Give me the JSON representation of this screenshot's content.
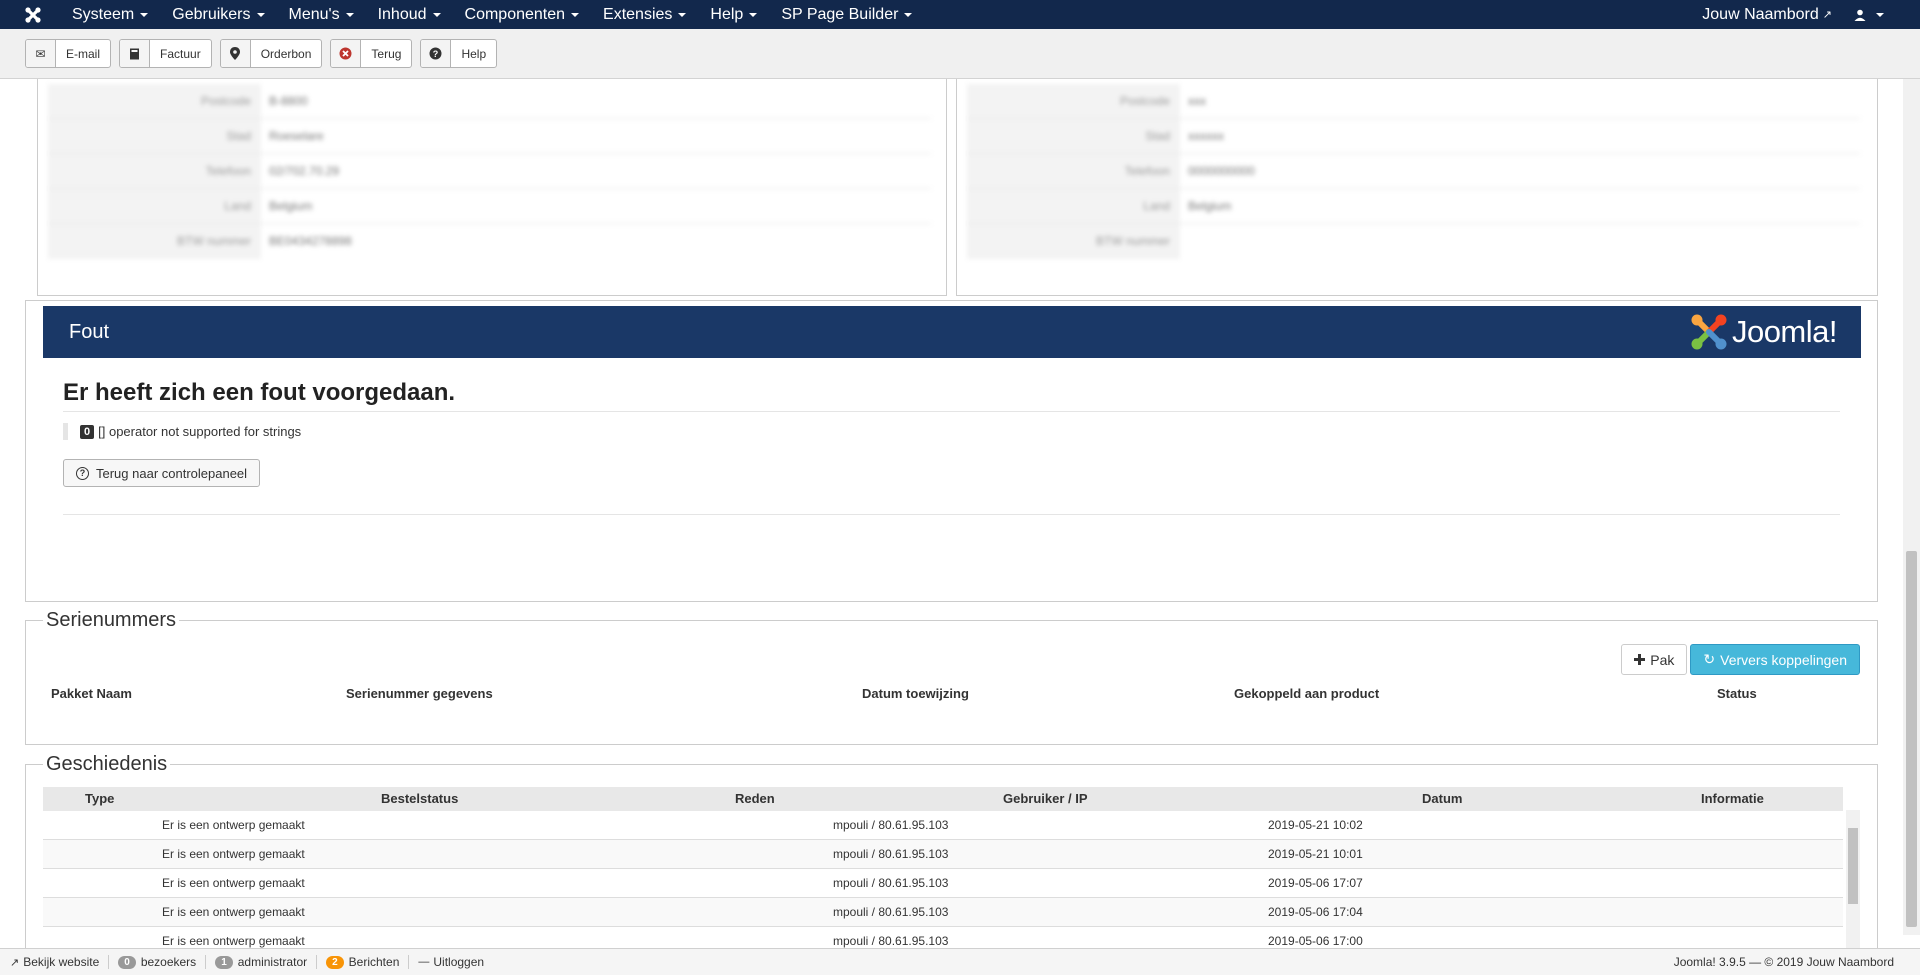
{
  "navbar": {
    "menu": [
      "Systeem",
      "Gebruikers",
      "Menu's",
      "Inhoud",
      "Componenten",
      "Extensies",
      "Help",
      "SP Page Builder"
    ],
    "user_label": "Jouw Naambord"
  },
  "toolbar": {
    "email": "E-mail",
    "factuur": "Factuur",
    "orderbon": "Orderbon",
    "terug": "Terug",
    "help": "Help"
  },
  "address_left": {
    "rows": [
      {
        "key": "Postcode",
        "value": "B-8800"
      },
      {
        "key": "Stad",
        "value": "Roeselare"
      },
      {
        "key": "Telefoon",
        "value": "02/702.70.29"
      },
      {
        "key": "Land",
        "value": "Belgium"
      },
      {
        "key": "BTW nummer",
        "value": "BE0434278898"
      }
    ]
  },
  "address_right": {
    "rows": [
      {
        "key": "Postcode",
        "value": "xxx"
      },
      {
        "key": "Stad",
        "value": "xxxxxx"
      },
      {
        "key": "Telefoon",
        "value": "0000000000"
      },
      {
        "key": "Land",
        "value": "Belgium"
      },
      {
        "key": "BTW nummer",
        "value": ""
      }
    ]
  },
  "error": {
    "title": "Fout",
    "logo_text": "Joomla!",
    "heading": "Er heeft zich een fout voorgedaan.",
    "code": "0",
    "message": "[] operator not supported for strings",
    "back_button": "Terug naar controlepaneel"
  },
  "serienummers": {
    "legend": "Serienummers",
    "btn_pak": "Pak",
    "btn_ververs": "Ververs koppelingen",
    "columns": [
      "Pakket Naam",
      "Serienummer gegevens",
      "Datum toewijzing",
      "Gekoppeld aan product",
      "Status"
    ]
  },
  "geschiedenis": {
    "legend": "Geschiedenis",
    "columns": [
      "Type",
      "Bestelstatus",
      "Reden",
      "Gebruiker / IP",
      "Datum",
      "Informatie"
    ],
    "rows": [
      {
        "status": "Er is een ontwerp gemaakt",
        "user_ip": "mpouli / 80.61.95.103",
        "date": "2019-05-21 10:02"
      },
      {
        "status": "Er is een ontwerp gemaakt",
        "user_ip": "mpouli / 80.61.95.103",
        "date": "2019-05-21 10:01"
      },
      {
        "status": "Er is een ontwerp gemaakt",
        "user_ip": "mpouli / 80.61.95.103",
        "date": "2019-05-06 17:07"
      },
      {
        "status": "Er is een ontwerp gemaakt",
        "user_ip": "mpouli / 80.61.95.103",
        "date": "2019-05-06 17:04"
      },
      {
        "status": "Er is een ontwerp gemaakt",
        "user_ip": "mpouli / 80.61.95.103",
        "date": "2019-05-06 17:00"
      }
    ]
  },
  "statusbar": {
    "view_site": "Bekijk website",
    "visitors_count": "0",
    "visitors_label": "bezoekers",
    "admin_count": "1",
    "admin_label": "administrator",
    "messages_count": "2",
    "messages_label": "Berichten",
    "logout": "Uitloggen",
    "version": "Joomla! 3.9.5 — © 2019 Jouw Naambord"
  }
}
